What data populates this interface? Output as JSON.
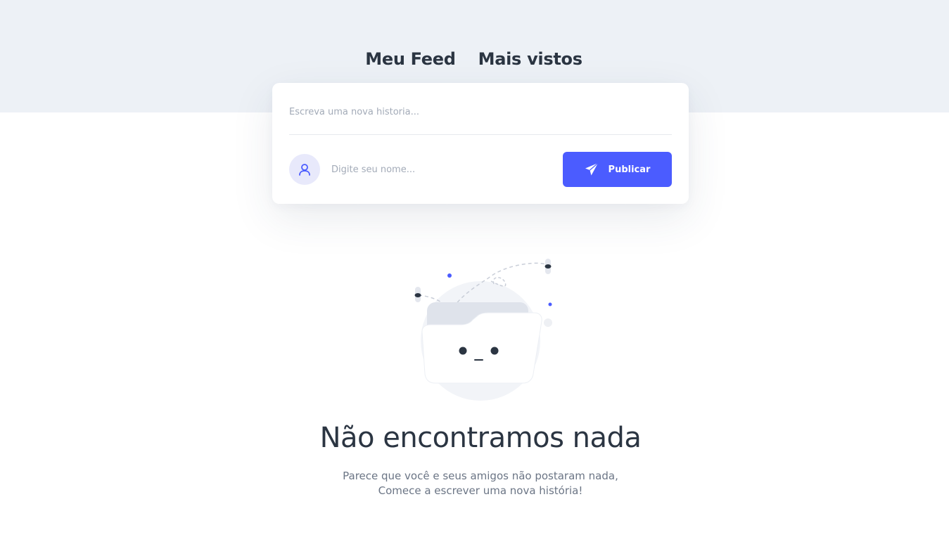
{
  "tabs": [
    {
      "label": "Meu Feed"
    },
    {
      "label": "Mais vistos"
    }
  ],
  "composer": {
    "story_placeholder": "Escreva uma nova historia...",
    "name_placeholder": "Digite seu nome...",
    "publish_label": "Publicar",
    "avatar_icon": "user-icon",
    "publish_icon": "paper-plane-icon"
  },
  "empty_state": {
    "title": "Não encontramos nada",
    "line1": "Parece que você e seus amigos não postaram nada,",
    "line2": "Comece a escrever uma nova história!",
    "illustration": "empty-folder-illustration"
  },
  "colors": {
    "accent": "#4b5cff",
    "text_dark": "#2b3542",
    "band": "#edf1f6"
  }
}
